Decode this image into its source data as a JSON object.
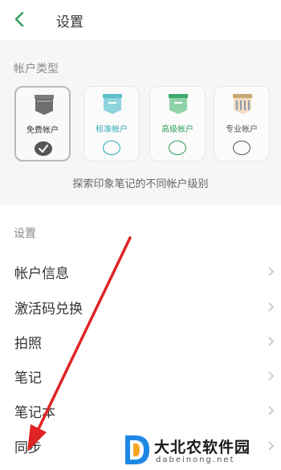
{
  "header": {
    "title": "设置"
  },
  "account_types": {
    "section_label": "帐户类型",
    "plans": [
      {
        "name": "免费帐户",
        "color": "#555555",
        "selected": true,
        "icon": "free-plan-icon"
      },
      {
        "name": "标准帐户",
        "color": "#2ba8b8",
        "selected": false,
        "icon": "standard-plan-icon"
      },
      {
        "name": "高级帐户",
        "color": "#2e9e5f",
        "selected": false,
        "icon": "premium-plan-icon"
      },
      {
        "name": "专业帐户",
        "color": "#555555",
        "selected": false,
        "icon": "professional-plan-icon"
      }
    ],
    "explore_text": "探索印象笔记的不同帐户级别"
  },
  "settings": {
    "section_label": "设置",
    "items": [
      {
        "label": "帐户信息"
      },
      {
        "label": "激活码兑换"
      },
      {
        "label": "拍照"
      },
      {
        "label": "笔记"
      },
      {
        "label": "笔记本"
      },
      {
        "label": "同步"
      }
    ]
  },
  "watermark": {
    "text": "大北农软件园",
    "subtext": "dabeinong.net"
  },
  "colors": {
    "accent": "#2e9e5f",
    "annotation_arrow": "#e02424"
  }
}
